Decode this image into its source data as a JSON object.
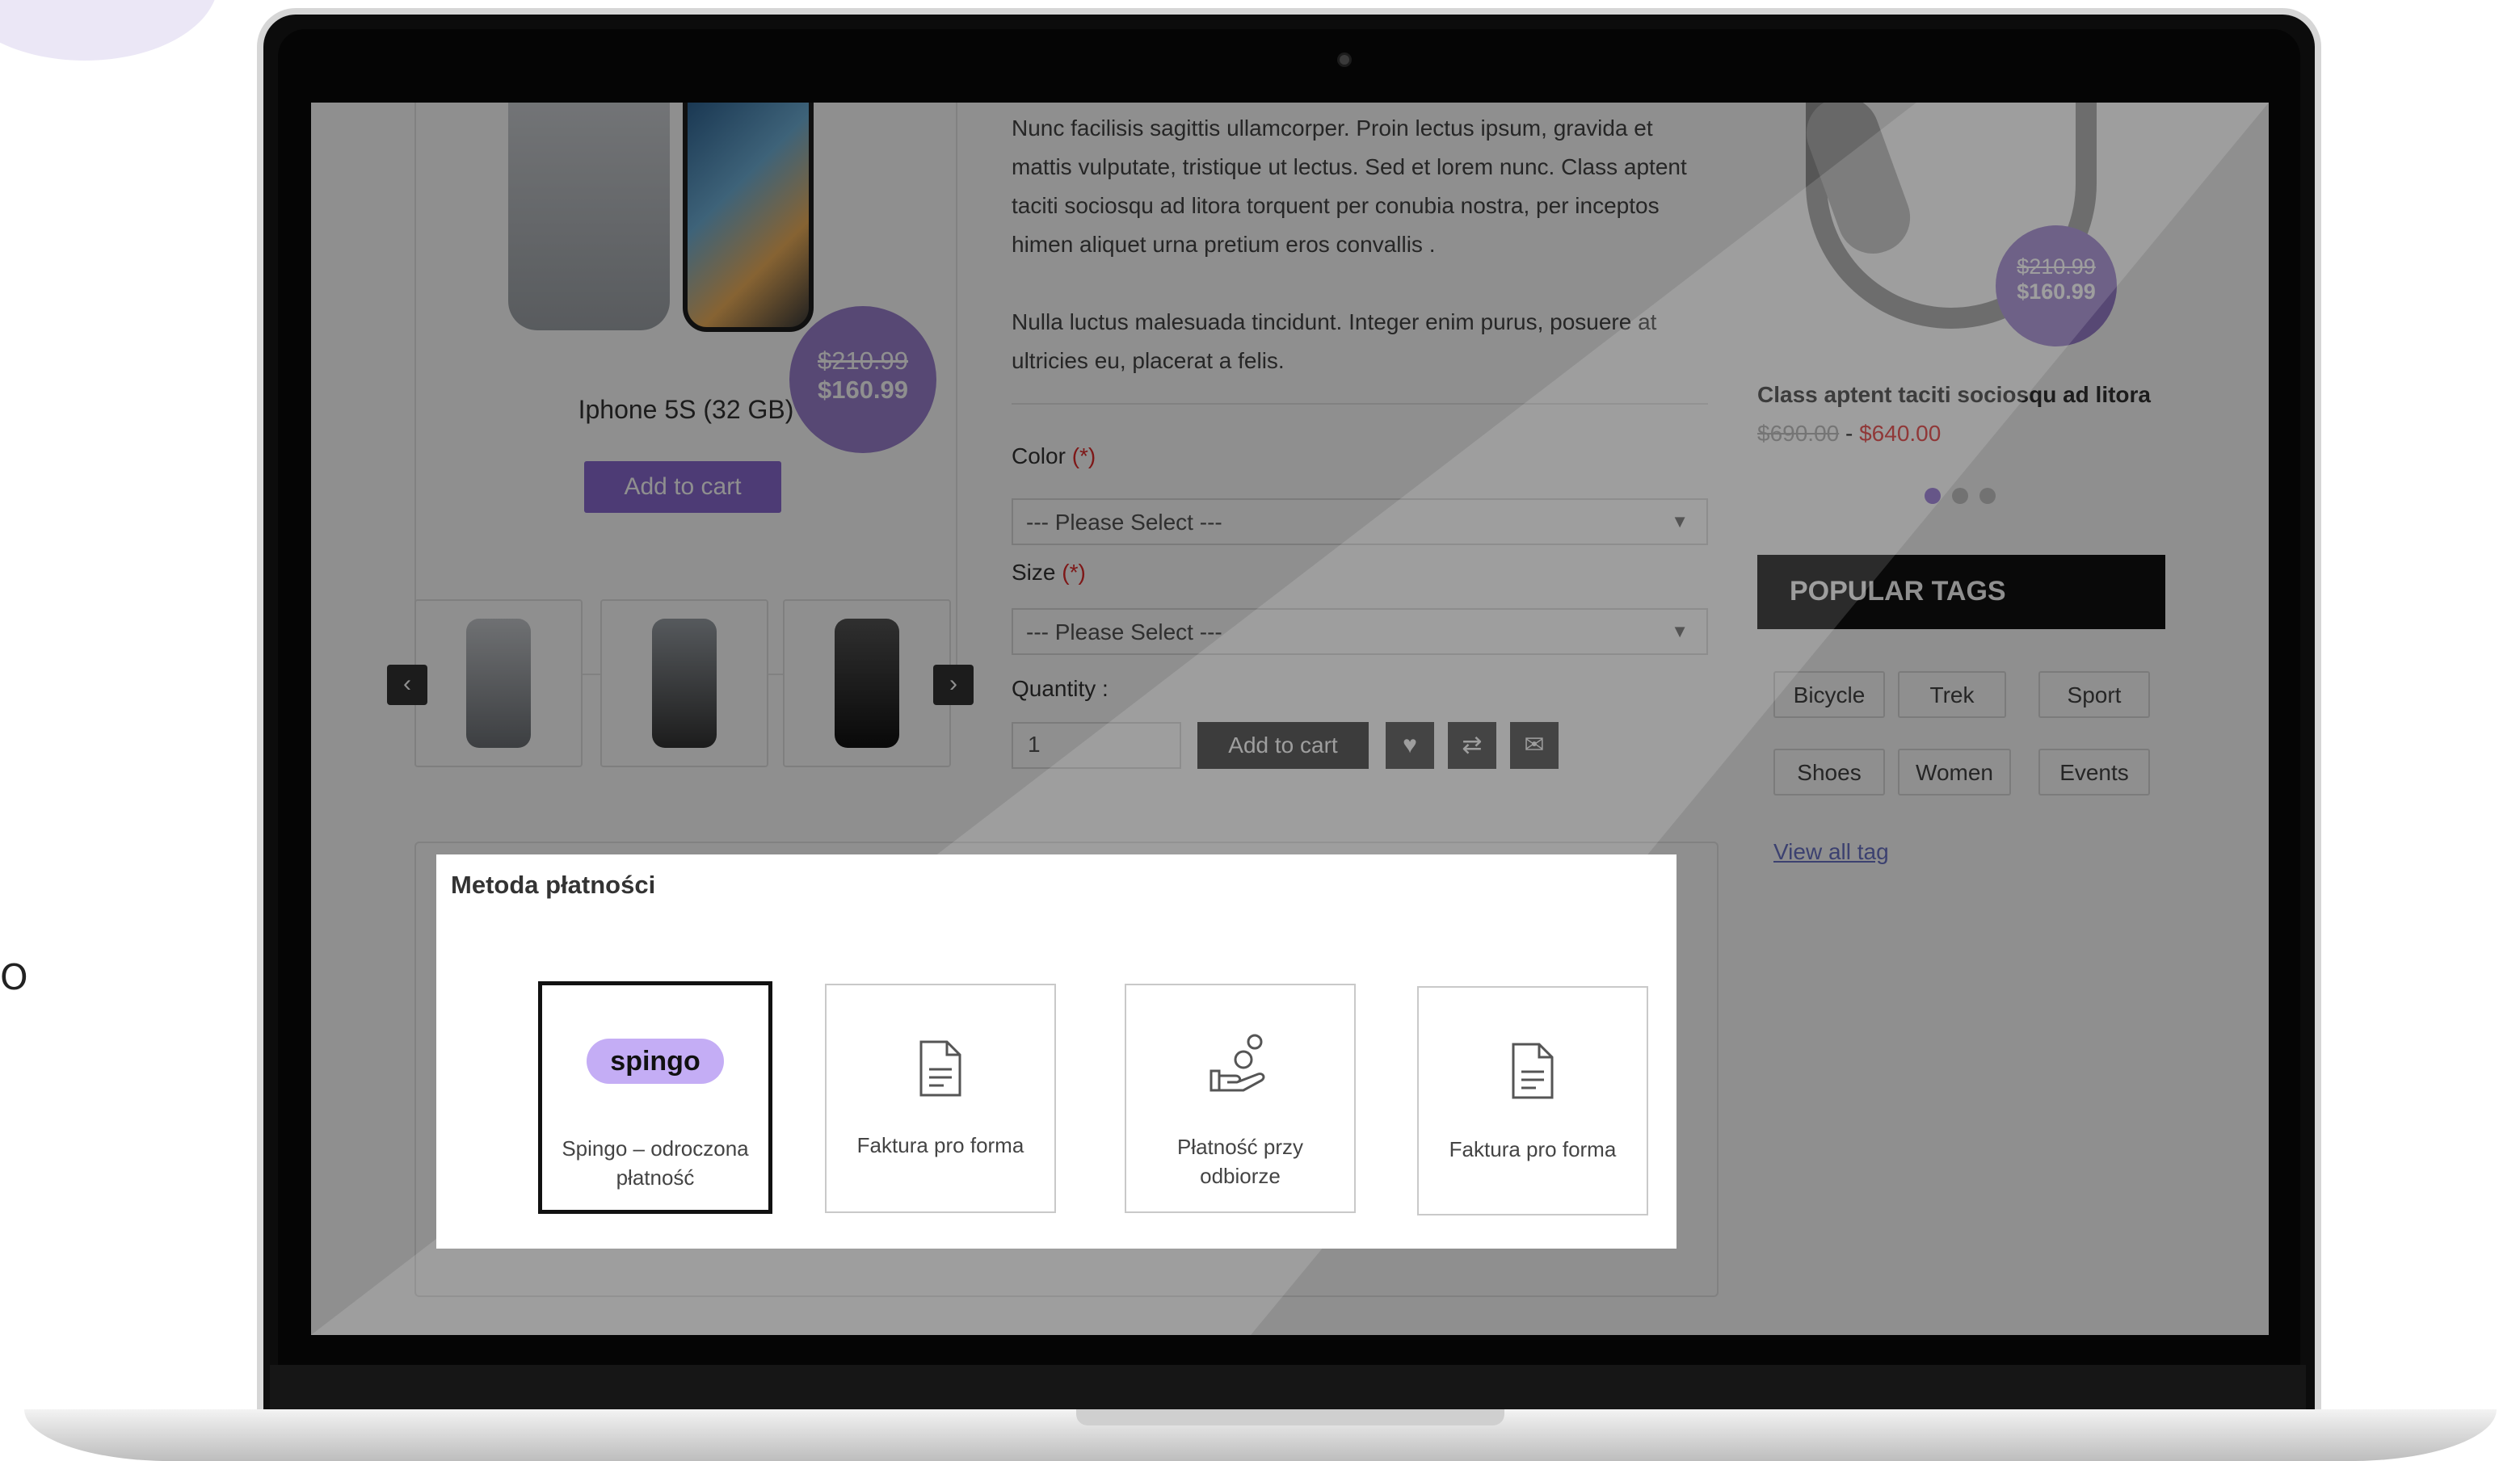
{
  "product": {
    "name": "Iphone 5S (32 GB)",
    "price_old": "$210.99",
    "price_new": "$160.99",
    "add_to_cart": "Add to cart"
  },
  "description": {
    "paragraph1": "Nunc facilisis sagittis ullamcorper. Proin lectus ipsum, gravida et mattis vulputate, tristique ut lectus. Sed et lorem nunc. Class aptent taciti sociosqu ad litora torquent per conubia nostra, per inceptos himen aliquet urna pretium eros convallis .",
    "paragraph2": "Nulla luctus malesuada tincidunt. Integer enim purus, posuere at ultricies eu, placerat a felis."
  },
  "options": {
    "color_label": "Color",
    "size_label": "Size",
    "required_mark": "(*)",
    "placeholder": "--- Please Select ---",
    "quantity_label": "Quantity :",
    "quantity_value": "1",
    "add_to_cart": "Add to cart"
  },
  "related": {
    "title": "Class aptent taciti sociosqu ad litora",
    "price_old": "$690.00",
    "price_new": "$640.00",
    "bubble_old": "$210.99",
    "bubble_new": "$160.99"
  },
  "tags": {
    "heading": "POPULAR TAGS",
    "items": [
      "Bicycle",
      "Trek",
      "Sport",
      "Shoes",
      "Women",
      "Events"
    ],
    "view_all": "View all tag"
  },
  "payment": {
    "title": "Metoda płatności",
    "spingo_logo": "spingo",
    "methods": [
      {
        "label": "Spingo – odroczona płatność",
        "icon": "spingo-logo",
        "selected": true
      },
      {
        "label": "Faktura pro forma",
        "icon": "document-icon",
        "selected": false
      },
      {
        "label": "Płatność przy odbiorze",
        "icon": "hand-coins-icon",
        "selected": false
      },
      {
        "label": "Faktura pro forma",
        "icon": "document-icon",
        "selected": false
      }
    ]
  },
  "side_text": "O",
  "colors": {
    "accent": "#8a6ad0",
    "spingo": "#c4adf5",
    "sale": "#e02b2b"
  }
}
